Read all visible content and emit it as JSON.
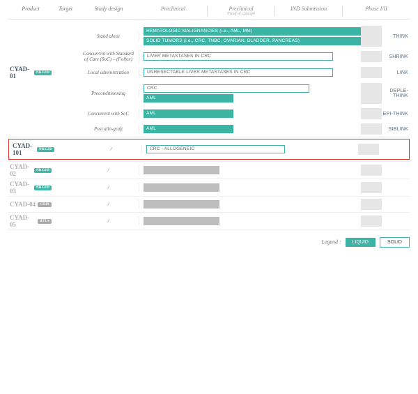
{
  "headers": {
    "product": "Product",
    "target": "Target",
    "study_design": "Study design",
    "phases": [
      "Preclinical",
      "Preclinical",
      "IND Submission",
      "Phase I/II"
    ],
    "phase_sub": [
      "",
      "Proof of concept",
      "",
      ""
    ]
  },
  "products": [
    {
      "name": "CYAD-01",
      "target": "NKG2D",
      "target_style": "teal",
      "highlight": false,
      "faded": false,
      "studies": [
        {
          "design": "Stand alone",
          "trial": "THINK",
          "bars": [
            {
              "label": "HEMATOLOGIC MALIGNANCIES (i.e., AML, MM)",
              "style": "liquid",
              "width_pct": 96
            },
            {
              "label": "SOLID TUMORS (i.e., CRC, TNBC, OVARIAN, BLADDER, PANCREAS)",
              "style": "liquid",
              "width_pct": 96
            }
          ]
        },
        {
          "design": "Concurrent with Standard of Care (SoC) – (Folfox)",
          "trial": "SHRINK",
          "bars": [
            {
              "label": "LIVER METASTASES IN CRC",
              "style": "solid-outline",
              "width_pct": 80
            }
          ]
        },
        {
          "design": "Local administration",
          "trial": "LINK",
          "bars": [
            {
              "label": "UNRESECTABLE LIVER METASTASES IN CRC",
              "style": "solid-outline",
              "width_pct": 80
            }
          ]
        },
        {
          "design": "Preconditionning",
          "trial": "DEPLE-THINK",
          "bars": [
            {
              "label": "CRC",
              "style": "solid-outline",
              "width_pct": 70
            },
            {
              "label": "AML",
              "style": "liquid",
              "width_pct": 38
            }
          ]
        },
        {
          "design": "Concurrent with SoC",
          "trial": "EPI-THINK",
          "bars": [
            {
              "label": "AML",
              "style": "liquid",
              "width_pct": 38
            }
          ]
        },
        {
          "design": "Post allo-graft",
          "trial": "SIBLINK",
          "bars": [
            {
              "label": "AML",
              "style": "liquid",
              "width_pct": 38
            }
          ]
        }
      ]
    },
    {
      "name": "CYAD-101",
      "target": "NKG2D",
      "target_style": "teal",
      "highlight": true,
      "faded": false,
      "studies": [
        {
          "design": "/",
          "trial": "",
          "bars": [
            {
              "label": "CRC - ALLOGENEIC",
              "style": "solid-outline",
              "width_pct": 60
            }
          ]
        }
      ]
    },
    {
      "name": "CYAD-02",
      "target": "NKG2D",
      "target_style": "teal",
      "highlight": false,
      "faded": true,
      "studies": [
        {
          "design": "/",
          "trial": "",
          "bars": [
            {
              "label": "",
              "style": "grey",
              "width_pct": 32
            }
          ]
        }
      ]
    },
    {
      "name": "CYAD-03",
      "target": "NKG2D",
      "target_style": "teal",
      "highlight": false,
      "faded": true,
      "studies": [
        {
          "design": "/",
          "trial": "",
          "bars": [
            {
              "label": "",
              "style": "grey",
              "width_pct": 32
            }
          ]
        }
      ]
    },
    {
      "name": "CYAD-04",
      "target": "CD19",
      "target_style": "grey",
      "highlight": false,
      "faded": true,
      "studies": [
        {
          "design": "/",
          "trial": "",
          "bars": [
            {
              "label": "",
              "style": "grey",
              "width_pct": 32
            }
          ]
        }
      ]
    },
    {
      "name": "CYAD-05",
      "target": "BTU4",
      "target_style": "grey",
      "highlight": false,
      "faded": true,
      "studies": [
        {
          "design": "/",
          "trial": "",
          "bars": [
            {
              "label": "",
              "style": "grey",
              "width_pct": 32
            }
          ]
        }
      ]
    }
  ],
  "legend": {
    "label": "Legend :",
    "liquid": "LIQUID",
    "solid": "SOLID"
  }
}
